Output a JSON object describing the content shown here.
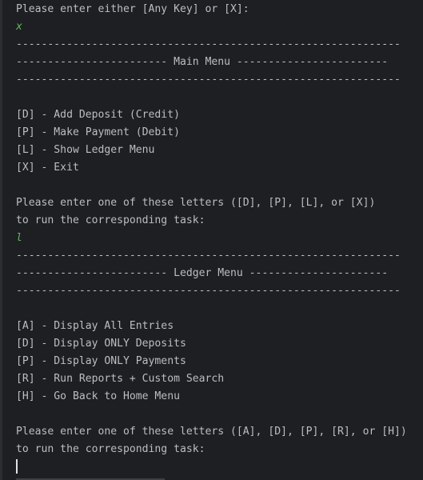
{
  "console": {
    "lines": [
      {
        "text": "Please enter either [Any Key] or [X]:",
        "kind": "output"
      },
      {
        "text": "x",
        "kind": "input"
      },
      {
        "text": "-------------------------------------------------------------",
        "kind": "output"
      },
      {
        "text": "------------------------ Main Menu ------------------------",
        "kind": "output"
      },
      {
        "text": "-------------------------------------------------------------",
        "kind": "output"
      },
      {
        "text": "",
        "kind": "output"
      },
      {
        "text": "[D] - Add Deposit (Credit)",
        "kind": "output"
      },
      {
        "text": "[P] - Make Payment (Debit)",
        "kind": "output"
      },
      {
        "text": "[L] - Show Ledger Menu",
        "kind": "output"
      },
      {
        "text": "[X] - Exit",
        "kind": "output"
      },
      {
        "text": "",
        "kind": "output"
      },
      {
        "text": "Please enter one of these letters ([D], [P], [L], or [X])",
        "kind": "output"
      },
      {
        "text": "to run the corresponding task:",
        "kind": "output"
      },
      {
        "text": "l",
        "kind": "input"
      },
      {
        "text": "-------------------------------------------------------------",
        "kind": "output"
      },
      {
        "text": "------------------------ Ledger Menu ----------------------",
        "kind": "output"
      },
      {
        "text": "-------------------------------------------------------------",
        "kind": "output"
      },
      {
        "text": "",
        "kind": "output"
      },
      {
        "text": "[A] - Display All Entries",
        "kind": "output"
      },
      {
        "text": "[D] - Display ONLY Deposits",
        "kind": "output"
      },
      {
        "text": "[P] - Display ONLY Payments",
        "kind": "output"
      },
      {
        "text": "[R] - Run Reports + Custom Search",
        "kind": "output"
      },
      {
        "text": "[H] - Go Back to Home Menu",
        "kind": "output"
      },
      {
        "text": "",
        "kind": "output"
      },
      {
        "text": "Please enter one of these letters ([A], [D], [P], [R], or [H])",
        "kind": "output"
      },
      {
        "text": "to run the corresponding task:",
        "kind": "output"
      }
    ]
  },
  "colors": {
    "background": "#1e1f22",
    "output_text": "#bcbec4",
    "user_input": "#5fb85f",
    "caret": "#dfe1e5"
  }
}
